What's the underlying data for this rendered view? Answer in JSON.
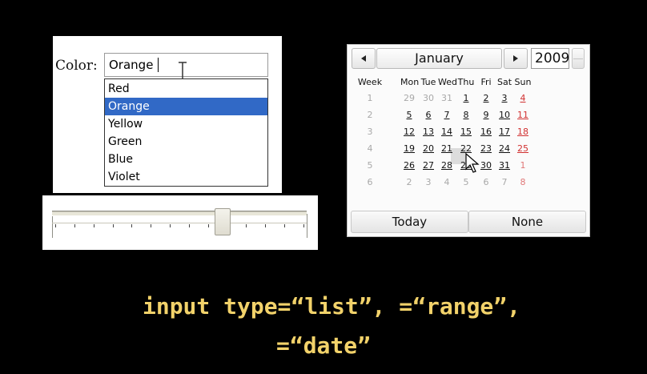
{
  "color_picker": {
    "label": "Color:",
    "value": "Orange",
    "options": [
      "Red",
      "Orange",
      "Yellow",
      "Green",
      "Blue",
      "Violet"
    ],
    "selected": "Orange"
  },
  "range": {
    "value_fraction": 0.67,
    "tick_count": 14
  },
  "date_picker": {
    "month": "January",
    "year": "2009",
    "headers": [
      "Week",
      "Mon",
      "Tue",
      "Wed",
      "Thu",
      "Fri",
      "Sat",
      "Sun"
    ],
    "weeks": [
      {
        "week": "1",
        "days": [
          "29",
          "30",
          "31",
          "1",
          "2",
          "3",
          "4"
        ]
      },
      {
        "week": "2",
        "days": [
          "5",
          "6",
          "7",
          "8",
          "9",
          "10",
          "11"
        ]
      },
      {
        "week": "3",
        "days": [
          "12",
          "13",
          "14",
          "15",
          "16",
          "17",
          "18"
        ]
      },
      {
        "week": "4",
        "days": [
          "19",
          "20",
          "21",
          "22",
          "23",
          "24",
          "25"
        ]
      },
      {
        "week": "5",
        "days": [
          "26",
          "27",
          "28",
          "29",
          "30",
          "31",
          "1"
        ]
      },
      {
        "week": "6",
        "days": [
          "2",
          "3",
          "4",
          "5",
          "6",
          "7",
          "8"
        ]
      }
    ],
    "hovered_day": "21",
    "today_label": "Today",
    "none_label": "None"
  },
  "caption": {
    "line1": "input type=“list”, =“range”,",
    "line2": "=“date”"
  },
  "colors": {
    "background": "#000000",
    "caption": "#f2d26a",
    "selection": "#3169c6",
    "weekend_red": "#d13030"
  }
}
